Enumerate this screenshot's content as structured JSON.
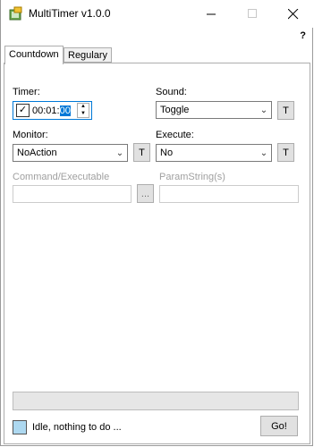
{
  "window": {
    "title": "MultiTimer v1.0.0",
    "help": "?"
  },
  "tabs": [
    {
      "label": "Countdown"
    },
    {
      "label": "Regulary"
    }
  ],
  "timer": {
    "label": "Timer:",
    "checked": true,
    "time_prefix": "00:01:",
    "time_selected": "00"
  },
  "sound": {
    "label": "Sound:",
    "value": "Toggle",
    "test_label": "T"
  },
  "monitor": {
    "label": "Monitor:",
    "value": "NoAction",
    "test_label": "T"
  },
  "execute": {
    "label": "Execute:",
    "value": "No",
    "test_label": "T"
  },
  "command": {
    "label": "Command/Executable",
    "value": "",
    "browse_label": "..."
  },
  "params": {
    "label": "ParamString(s)",
    "value": ""
  },
  "progress": {
    "value": 0
  },
  "status": {
    "text": "Idle, nothing to do ...",
    "color": "#add8f0"
  },
  "go": {
    "label": "Go!"
  },
  "icons": {
    "app": "timer-app-icon",
    "minimize": "minimize-icon",
    "maximize": "maximize-icon",
    "close": "close-icon"
  }
}
